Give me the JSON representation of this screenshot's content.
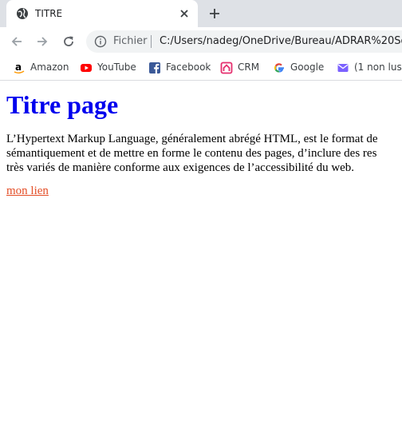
{
  "browser": {
    "tab": {
      "title": "TITRE"
    },
    "address_bar": {
      "chip_label": "Fichier",
      "url": "C:/Users/nadeg/OneDrive/Bureau/ADRAR%20Sof"
    },
    "bookmarks": [
      {
        "label": "Amazon",
        "icon": "amazon-icon"
      },
      {
        "label": "YouTube",
        "icon": "youtube-icon"
      },
      {
        "label": "Facebook",
        "icon": "facebook-icon"
      },
      {
        "label": "CRM",
        "icon": "crm-icon"
      },
      {
        "label": "Google",
        "icon": "google-icon"
      },
      {
        "label": "(1 non lus)",
        "icon": "mail-icon"
      }
    ]
  },
  "page": {
    "heading": "Titre page",
    "paragraph_lines": [
      "L’Hypertext Markup Language, généralement abrégé HTML, est le format de",
      "sémantiquement et de mettre en forme le contenu des pages, d’inclure des res",
      "très variés de manière conforme aux exigences de l’accessibilité du web."
    ],
    "link": "mon lien"
  },
  "colors": {
    "heading": "#0000ee",
    "link": "#e44d26",
    "tabstrip": "#dee1e6",
    "omnibox": "#f1f3f4"
  }
}
